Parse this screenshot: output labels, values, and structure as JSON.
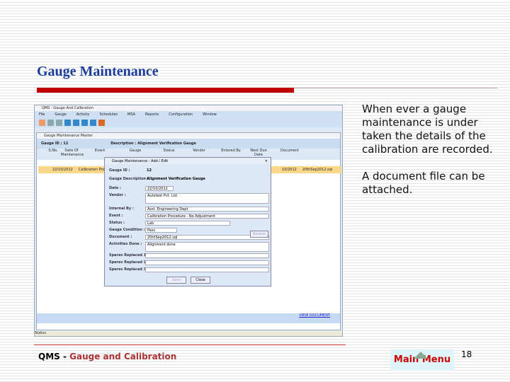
{
  "title": "Gauge Maintenance",
  "app": {
    "window_title": "QMS - Gauge And Calibration",
    "menu": [
      "File",
      "Gauge",
      "Activity",
      "Schedules",
      "MSA",
      "Reports",
      "Configuration",
      "Window"
    ],
    "child_title": "Gauge Maintenance Master",
    "gauge_id_label": "Gauge ID :",
    "gauge_id": "12",
    "description_label": "Description :",
    "description": "Alignment Verification Gauge",
    "columns": [
      "S.No.",
      "Date Of Maintenance",
      "Event",
      "Gauge",
      "Status",
      "Vendor",
      "Entered By",
      "Next Due Date",
      "Document"
    ],
    "row": {
      "date": "22/10/2012",
      "event": "Calibration Procedure Adjustment",
      "next_due": "10/2012",
      "document": "20thSep2012.sql"
    },
    "view_document": "VIEW DOCUMENT",
    "status": "Status"
  },
  "dialog": {
    "title": "Gauge Maintenance - Add / Edit",
    "fields": [
      {
        "label": "Gauge ID :",
        "value": "12"
      },
      {
        "label": "Gauge Description :",
        "value": "Alignment Verification Gauge"
      },
      {
        "label": "Date :",
        "value": "22/10/2012"
      },
      {
        "label": "Vendor :",
        "value": "Autotest Pvt. Ltd"
      },
      {
        "label": "Internal By :",
        "value": "Asst. Engineering Dept"
      },
      {
        "label": "Event :",
        "value": "Calibration Procedure - No Adjustment"
      },
      {
        "label": "Status :",
        "value": "Lab"
      },
      {
        "label": "Gauge Condition :",
        "value": "Pass"
      },
      {
        "label": "Document :",
        "value": "20thSep2012.sql"
      },
      {
        "label": "Activities Done :",
        "value": "Alignment done"
      },
      {
        "label": "Spares Replaced 1 :",
        "value": ""
      },
      {
        "label": "Spares Replaced 2 :",
        "value": ""
      },
      {
        "label": "Spares Replaced 3 :",
        "value": ""
      }
    ],
    "browse": "Browse",
    "save": "Save",
    "close": "Close"
  },
  "description": [
    "When ever a gauge maintenance is under taken the details of the calibration are recorded.",
    "A document file can be attached."
  ],
  "footer": {
    "prefix": "QMS",
    "sep": " - ",
    "name": "Gauge and Calibration",
    "main_menu": "Main Menu",
    "page": "18"
  }
}
